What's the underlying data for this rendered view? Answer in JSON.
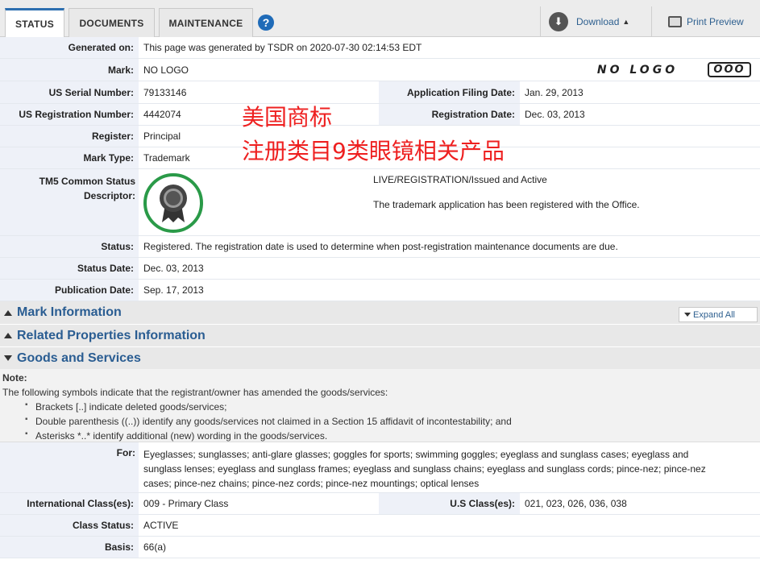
{
  "tabs": [
    {
      "label": "STATUS",
      "active": true
    },
    {
      "label": "DOCUMENTS",
      "active": false
    },
    {
      "label": "MAINTENANCE",
      "active": false
    }
  ],
  "toolbar": {
    "help_icon": "?",
    "download_label": "Download",
    "download_caret": "▲",
    "print_label": "Print Preview"
  },
  "fields": {
    "generated_on": {
      "label": "Generated on:",
      "value": "This page was generated by TSDR on 2020-07-30 02:14:53 EDT"
    },
    "mark": {
      "label": "Mark:",
      "value": "NO LOGO"
    },
    "mark_image_text": "NO LOGO",
    "mark_image_logo": "OOO",
    "serial": {
      "label": "US Serial Number:",
      "value": "79133146"
    },
    "filing_date": {
      "label": "Application Filing Date:",
      "value": "Jan. 29, 2013"
    },
    "registration_number": {
      "label": "US Registration Number:",
      "value": "4442074"
    },
    "registration_date": {
      "label": "Registration Date:",
      "value": "Dec. 03, 2013"
    },
    "register": {
      "label": "Register:",
      "value": "Principal"
    },
    "mark_type": {
      "label": "Mark Type:",
      "value": "Trademark"
    },
    "tm5": {
      "label_line1": "TM5 Common Status",
      "label_line2": "Descriptor:",
      "status_line": "LIVE/REGISTRATION/Issued and Active",
      "description": "The trademark application has been registered with the Office."
    },
    "status": {
      "label": "Status:",
      "value": "Registered. The registration date is used to determine when post-registration maintenance documents are due."
    },
    "status_date": {
      "label": "Status Date:",
      "value": "Dec. 03, 2013"
    },
    "publication_date": {
      "label": "Publication Date:",
      "value": "Sep. 17, 2013"
    }
  },
  "watermark": {
    "line1": "美国商标",
    "line2": "注册类目9类眼镜相关产品",
    "color": "#ee2020"
  },
  "sections": {
    "mark_information": "Mark Information",
    "related_properties": "Related Properties Information",
    "goods_and_services": "Goods and Services",
    "expand_all": "Expand All"
  },
  "note": {
    "title": "Note:",
    "intro": "The following symbols indicate that the registrant/owner has amended the goods/services:",
    "items": [
      "Brackets [..] indicate deleted goods/services;",
      "Double parenthesis ((..)) identify any goods/services not claimed in a Section 15 affidavit of incontestability; and",
      "Asterisks *..* identify additional (new) wording in the goods/services."
    ]
  },
  "goods": {
    "for_label": "For:",
    "for_lines": [
      "Eyeglasses; sunglasses; anti-glare glasses; goggles for sports; swimming goggles; eyeglass and sunglass cases; eyeglass and",
      "sunglass lenses; eyeglass and sunglass frames; eyeglass and sunglass chains; eyeglass and sunglass cords; pince-nez; pince-nez",
      "cases; pince-nez chains; pince-nez cords; pince-nez mountings; optical lenses"
    ],
    "intl_class_label": "International Class(es):",
    "intl_class_value": "009 - Primary Class",
    "us_class_label": "U.S Class(es):",
    "us_class_value": "021, 023, 026, 036, 038",
    "class_status_label": "Class Status:",
    "class_status_value": "ACTIVE",
    "basis_label": "Basis:",
    "basis_value": "66(a)"
  },
  "colors": {
    "accent": "#2a5d92",
    "badge_green": "#2a9a48",
    "label_bg": "#eef1f8"
  }
}
